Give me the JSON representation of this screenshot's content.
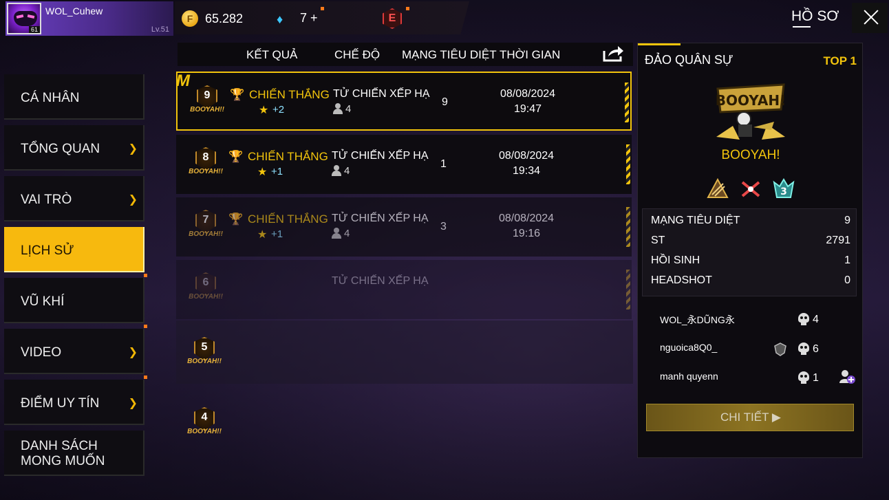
{
  "player": {
    "name": "WOL_Cuhew",
    "avatar_level": "61",
    "lv_text": "Lv.51"
  },
  "currency": {
    "gold_symbol": "F",
    "gold": "65.282",
    "diamond": "7",
    "diamond_plus": "+",
    "badge_letter": "E"
  },
  "header": {
    "title": "HỒ SƠ"
  },
  "sidebar": {
    "items": [
      {
        "label": "CÁ NHÂN",
        "chevron": false
      },
      {
        "label": "TỔNG QUAN",
        "chevron": true
      },
      {
        "label": "VAI TRÒ",
        "chevron": true
      },
      {
        "label": "LỊCH SỬ",
        "chevron": false,
        "active": true
      },
      {
        "label": "VŨ KHÍ",
        "chevron": false
      },
      {
        "label": "VIDEO",
        "chevron": true
      },
      {
        "label": "ĐIỂM UY TÍN",
        "chevron": true
      },
      {
        "label": "DANH SÁCH MONG MUỐN",
        "chevron": false
      }
    ]
  },
  "table": {
    "headers": [
      "KẾT QUẢ",
      "CHẾ ĐỘ",
      "MẠNG TIÊU DIỆT",
      "THỜI GIAN"
    ],
    "rows": [
      {
        "rank": "9",
        "badge_text": "BOOYAH!!",
        "result": "CHIẾN THẮNG",
        "stars": "+2",
        "mode": "TỬ CHIẾN XẾP HẠ",
        "players": "4",
        "kills": "9",
        "date": "08/08/2024",
        "time": "19:47"
      },
      {
        "rank": "8",
        "badge_text": "BOOYAH!!",
        "result": "CHIẾN THẮNG",
        "stars": "+1",
        "mode": "TỬ CHIẾN XẾP HẠ",
        "players": "4",
        "kills": "1",
        "date": "08/08/2024",
        "time": "19:34"
      },
      {
        "rank": "7",
        "badge_text": "BOOYAH!!",
        "result": "CHIẾN THẮNG",
        "stars": "+1",
        "mode": "TỬ CHIẾN XẾP HẠ",
        "players": "4",
        "kills": "3",
        "date": "08/08/2024",
        "time": "19:16"
      },
      {
        "rank": "6",
        "badge_text": "BOOYAH!!",
        "mode": "TỬ CHIẾN XẾP HẠ"
      },
      {
        "rank": "5",
        "badge_text": "BOOYAH!!"
      },
      {
        "rank": "4",
        "badge_text": "BOOYAH!!"
      }
    ]
  },
  "detail": {
    "map": "ĐẢO QUÂN SỰ",
    "placement": "TOP 1",
    "logo_text": "BOOYAH!",
    "booyah_label": "BOOYAH!",
    "stats": [
      {
        "label": "MẠNG TIÊU DIỆT",
        "value": "9"
      },
      {
        "label": "ST",
        "value": "2791"
      },
      {
        "label": "HỒI SINH",
        "value": "1"
      },
      {
        "label": "HEADSHOT",
        "value": "0"
      }
    ],
    "team": [
      {
        "name": "WOL_永DŨNG永",
        "kills": "4"
      },
      {
        "name": "nguoica8Q0_",
        "kills": "6"
      },
      {
        "name": "manh quyenn",
        "kills": "1"
      }
    ],
    "button": "CHI TIẾT ▶"
  }
}
